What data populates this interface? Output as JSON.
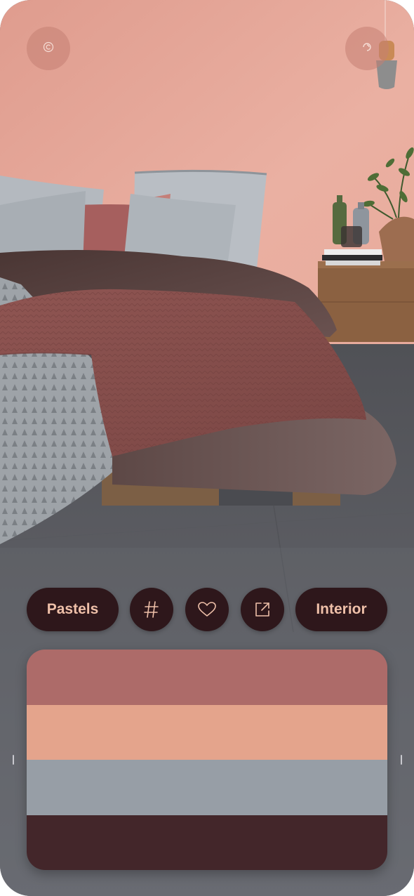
{
  "top_bar": {
    "left_button_icon": "copyright-icon",
    "right_button_icon": "swirl-icon"
  },
  "chips": {
    "category_left": "Pastels",
    "category_right": "Interior",
    "hash_icon": "hash-icon",
    "favorite_icon": "heart-icon",
    "share_icon": "share-icon"
  },
  "palette": {
    "colors": [
      "#ad6b69",
      "#e4a48c",
      "#979ea6",
      "#43262a"
    ]
  },
  "theme": {
    "wall": "#e6a89a",
    "floor": "#5f6066",
    "chip_bg": "#2e171b",
    "chip_text": "#efc0a9"
  }
}
